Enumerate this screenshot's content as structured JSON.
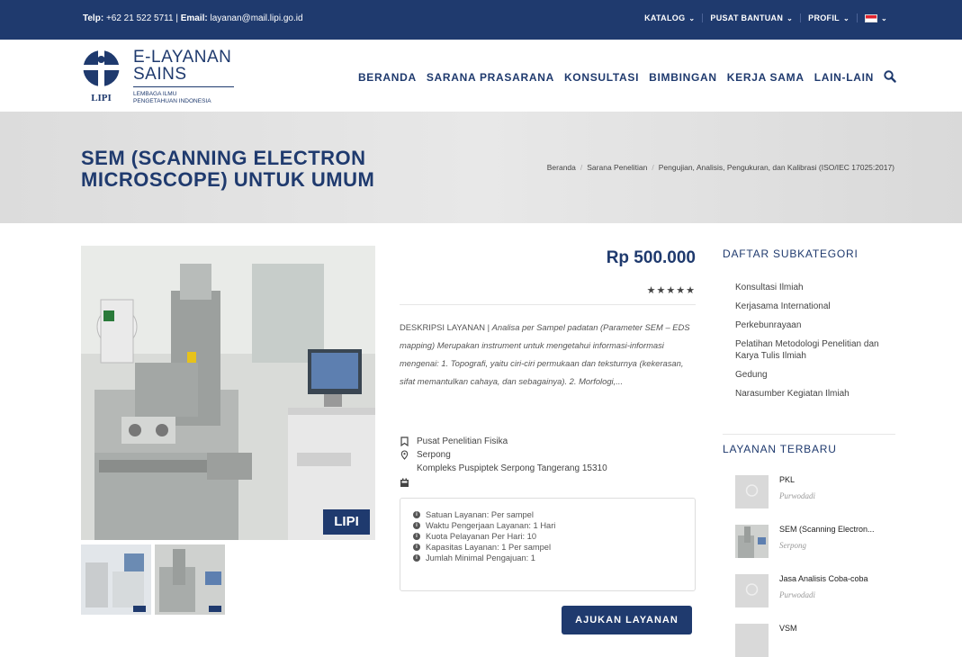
{
  "topbar": {
    "phone_label": "Telp:",
    "phone": "+62 21 522 5711",
    "separator": "|",
    "email_label": "Email:",
    "email": "layanan@mail.lipi.go.id",
    "nav": [
      "KATALOG",
      "PUSAT BANTUAN",
      "PROFIL"
    ]
  },
  "logo": {
    "title_line1": "E-LAYANAN",
    "title_line2": "SAINS",
    "sub_line1": "LEMBAGA ILMU",
    "sub_line2": "PENGETAHUAN INDONESIA",
    "mark_text": "LIPI"
  },
  "mainnav": [
    "BERANDA",
    "SARANA PRASARANA",
    "KONSULTASI",
    "BIMBINGAN",
    "KERJA SAMA",
    "LAIN-LAIN"
  ],
  "hero": {
    "title": "SEM (SCANNING ELECTRON MICROSCOPE) UNTUK UMUM",
    "breadcrumb": [
      "Beranda",
      "Sarana Penelitian",
      "Pengujian, Analisis, Pengukuran, dan Kalibrasi (ISO/IEC 17025:2017)"
    ]
  },
  "product": {
    "image_badge": "LIPI",
    "price": "Rp 500.000",
    "rating_stars": 5,
    "desc_label": "DESKRIPSI LAYANAN |",
    "desc_text": "Analisa per Sampel padatan (Parameter SEM – EDS mapping) Merupakan instrument untuk mengetahui informasi-informasi mengenai: 1. Topografi, yaitu ciri-ciri permukaan dan teksturnya (kekerasan, sifat memantulkan cahaya, dan sebagainya). 2. Morfologi,...",
    "unit": "Pusat Penelitian Fisika",
    "location": "Serpong",
    "address": "Kompleks Puspiptek Serpong Tangerang 15310",
    "specs": [
      "Satuan Layanan: Per sampel",
      "Waktu Pengerjaan Layanan: 1 Hari",
      "Kuota Pelayanan Per Hari: 10",
      "Kapasitas Layanan: 1 Per sampel",
      "Jumlah Minimal Pengajuan: 1"
    ],
    "cta": "AJUKAN LAYANAN"
  },
  "sidebar": {
    "subcat_title": "DAFTAR SUBKATEGORI",
    "subcats": [
      "Konsultasi Ilmiah",
      "Kerjasama International",
      "Perkebunrayaan",
      "Pelatihan Metodologi Penelitian dan Karya Tulis Ilmiah",
      "Gedung",
      "Narasumber Kegiatan Ilmiah"
    ],
    "latest_title": "LAYANAN TERBARU",
    "latest": [
      {
        "title": "PKL",
        "loc": "Purwodadi"
      },
      {
        "title": "SEM (Scanning Electron...",
        "loc": "Serpong"
      },
      {
        "title": "Jasa Analisis Coba-coba",
        "loc": "Purwodadi"
      },
      {
        "title": "VSM",
        "loc": ""
      }
    ]
  },
  "colors": {
    "brand": "#1f3a6e"
  }
}
